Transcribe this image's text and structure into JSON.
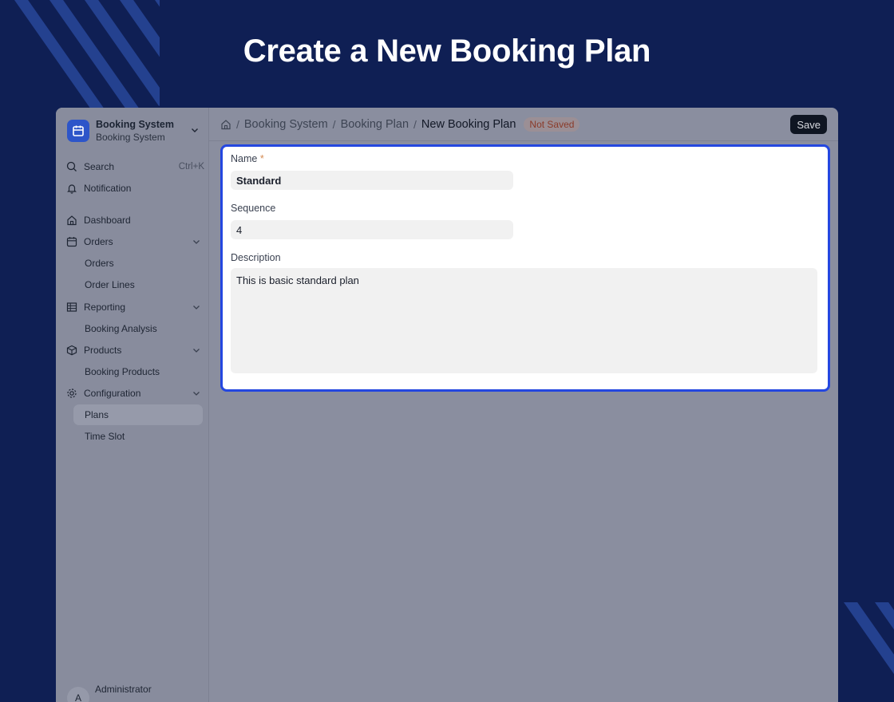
{
  "headline": "Create a New Booking Plan",
  "app": {
    "name": "Booking System",
    "subtitle": "Booking System"
  },
  "sidebar": {
    "search_label": "Search",
    "search_shortcut": "Ctrl+K",
    "notification_label": "Notification",
    "items": [
      {
        "label": "Dashboard",
        "icon": "home-icon"
      },
      {
        "label": "Orders",
        "icon": "calendar-icon",
        "children": [
          "Orders",
          "Order Lines"
        ]
      },
      {
        "label": "Reporting",
        "icon": "table-icon",
        "children": [
          "Booking Analysis"
        ]
      },
      {
        "label": "Products",
        "icon": "box-icon",
        "children": [
          "Booking Products"
        ]
      },
      {
        "label": "Configuration",
        "icon": "gear-icon",
        "children": [
          "Plans",
          "Time Slot"
        ]
      }
    ],
    "active_item": "Plans",
    "user": {
      "avatar_initial": "A",
      "name": "Administrator"
    }
  },
  "breadcrumb": [
    "Booking System",
    "Booking Plan",
    "New Booking Plan"
  ],
  "status_badge": "Not Saved",
  "save_label": "Save",
  "form": {
    "name_label": "Name",
    "name_required_mark": "*",
    "name_value": "Standard",
    "sequence_label": "Sequence",
    "sequence_value": "4",
    "description_label": "Description",
    "description_value": "This is basic standard plan"
  },
  "colors": {
    "page_background": "#0f1f54",
    "accent_border": "#2447e0",
    "app_logo": "#2d55c9"
  }
}
